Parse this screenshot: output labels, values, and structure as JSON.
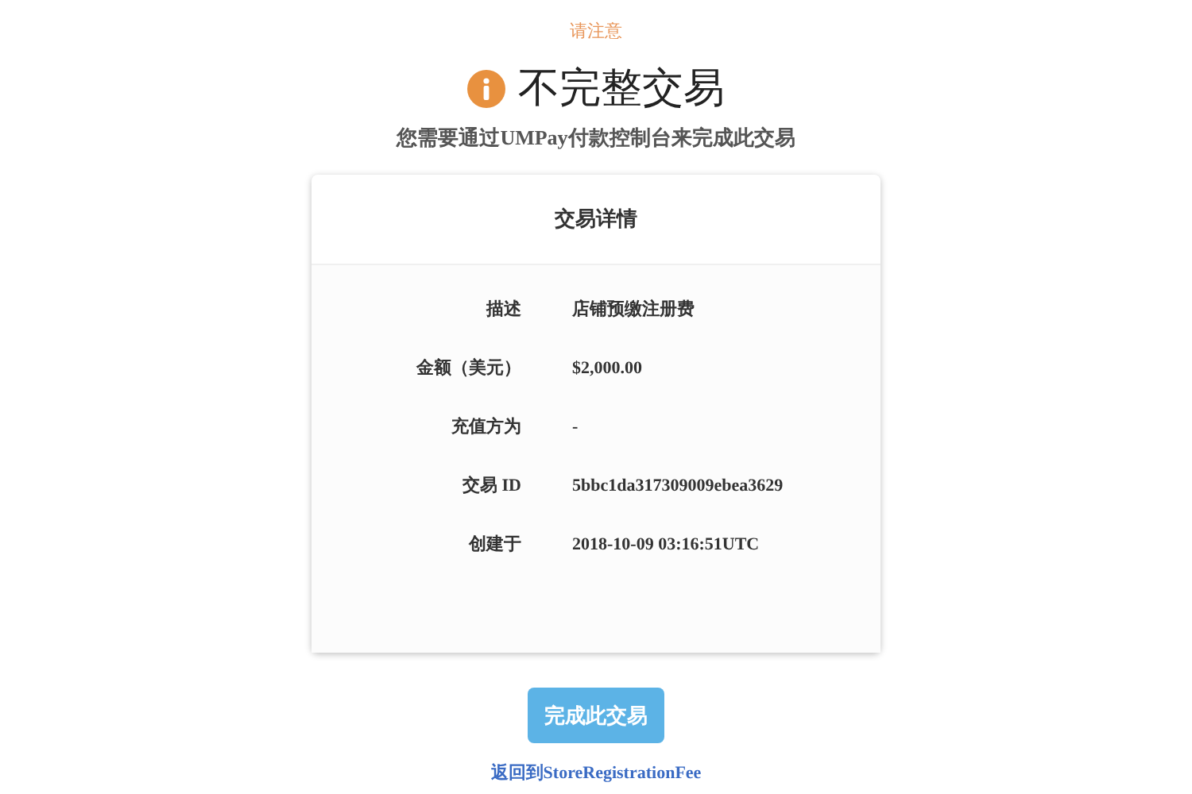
{
  "notice": "请注意",
  "title": "不完整交易",
  "subtitle": "您需要通过UMPay付款控制台来完成此交易",
  "card": {
    "title": "交易详情",
    "rows": [
      {
        "label": "描述",
        "value": "店铺预缴注册费"
      },
      {
        "label": "金额（美元）",
        "value": "$2,000.00"
      },
      {
        "label": "充值方为",
        "value": "-"
      },
      {
        "label": "交易 ID",
        "value": "5bbc1da317309009ebea3629"
      },
      {
        "label": "创建于",
        "value": "2018-10-09 03:16:51UTC"
      }
    ]
  },
  "button": "完成此交易",
  "link": "返回到StoreRegistrationFee"
}
